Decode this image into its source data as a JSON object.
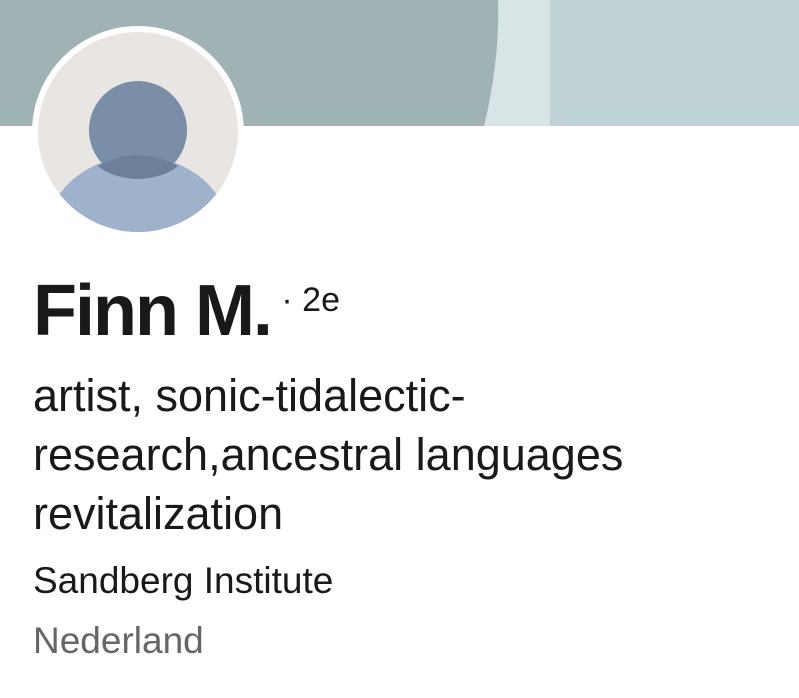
{
  "profile": {
    "name": "Finn M.",
    "degree": "· 2e",
    "headline_lines": [
      "artist, sonic-tidalectic-",
      "research,ancestral languages",
      "revitalization"
    ],
    "organization": "Sandberg Institute",
    "location": "Nederland"
  },
  "icons": {
    "avatar": "default-person-avatar-icon"
  },
  "colors": {
    "banner_main": "#9fb2b4",
    "banner_light": "#d9e4e6",
    "banner_right": "#bfd3d7",
    "avatar_bg": "#e9e5e3",
    "avatar_head": "#7b8ea8",
    "avatar_body": "#9eb2cb",
    "text_primary": "#191919",
    "text_secondary": "#666666"
  }
}
